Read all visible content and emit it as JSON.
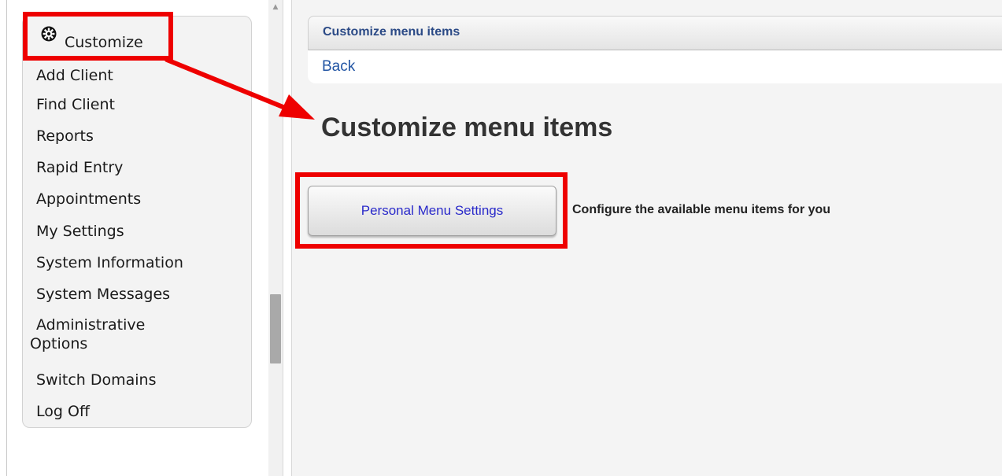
{
  "sidebar": {
    "customize_label": "Customize",
    "items": [
      {
        "label": "Add Client"
      },
      {
        "label": "Find Client"
      },
      {
        "label": "Reports"
      },
      {
        "label": "Rapid Entry"
      },
      {
        "label": "Appointments"
      },
      {
        "label": "My Settings"
      },
      {
        "label": "System Information"
      },
      {
        "label": "System Messages"
      },
      {
        "label_line1": "Administrative",
        "label_line2": "Options"
      },
      {
        "label": "Switch Domains"
      },
      {
        "label": "Log Off"
      }
    ]
  },
  "header": {
    "title": "Customize menu items"
  },
  "nav": {
    "back_label": "Back"
  },
  "main": {
    "page_title": "Customize menu items",
    "personal_menu_button": "Personal Menu Settings",
    "personal_menu_description": "Configure the available menu items for you"
  },
  "colors": {
    "annotation": "#ee0000",
    "link": "#2255a4",
    "header_text": "#2b4a86",
    "button_text": "#2a2aca"
  }
}
